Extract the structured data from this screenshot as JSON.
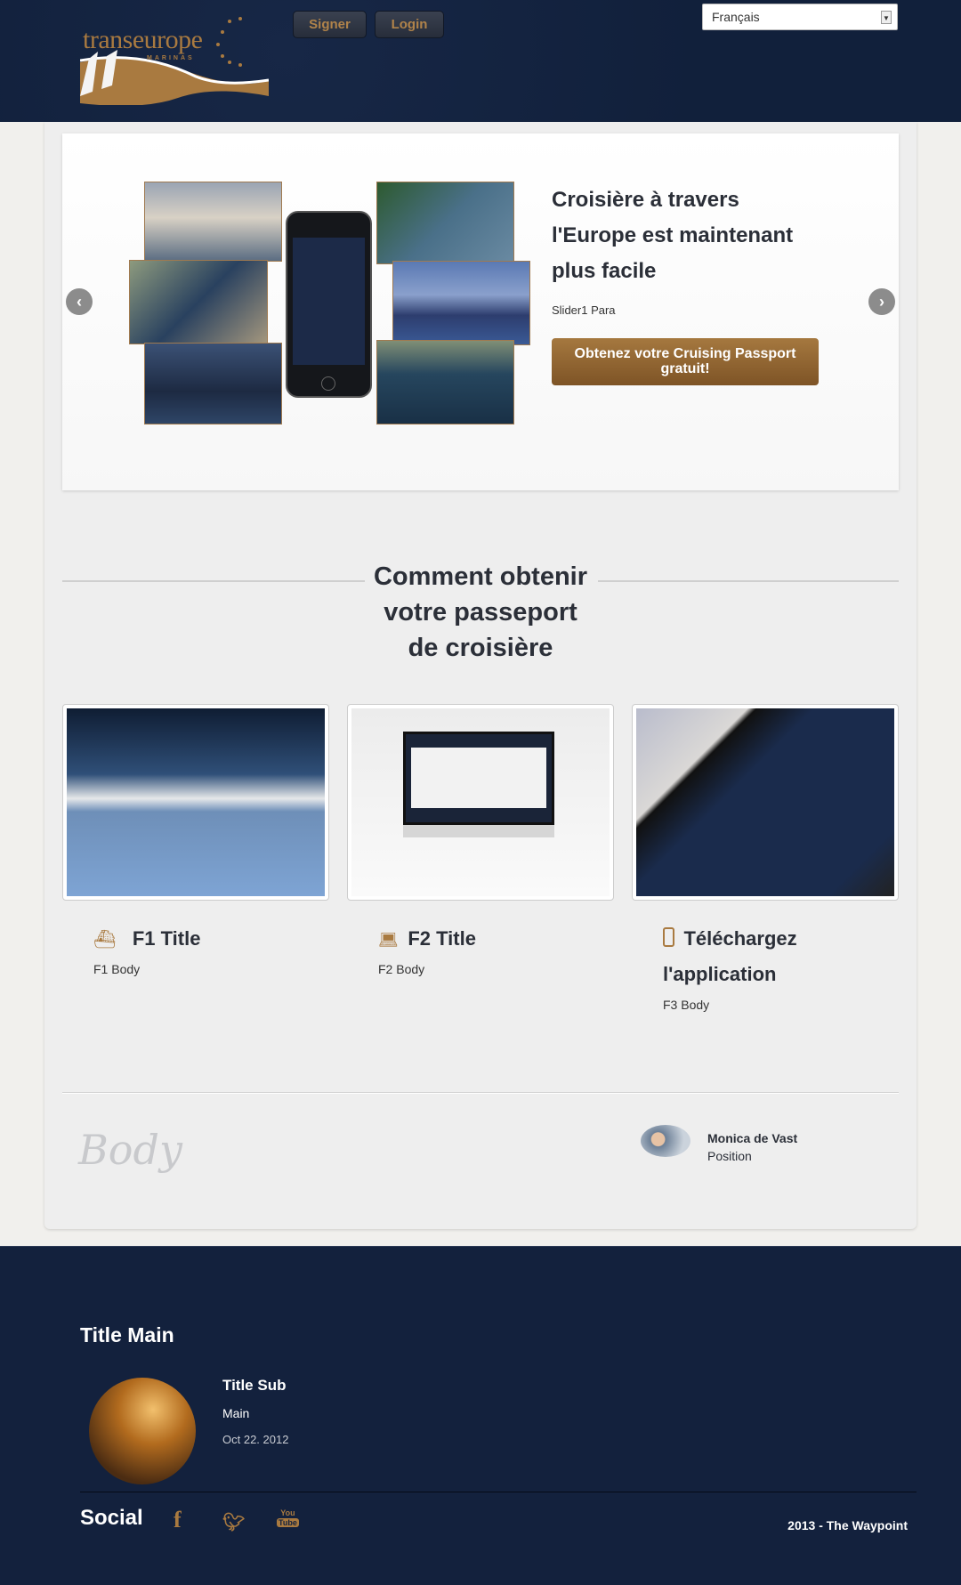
{
  "header": {
    "logo": {
      "text": "transeurope",
      "sub": "MARINAS"
    },
    "signup_label": "Signer",
    "login_label": "Login",
    "language": "Français"
  },
  "slider": {
    "title": "Croisière à travers l'Europe est maintenant plus facile",
    "para": "Slider1 Para",
    "cta_label": "Obtenez votre Cruising Passport gratuit!",
    "prev_icon": "chevron-left-icon",
    "next_icon": "chevron-right-icon"
  },
  "howto": {
    "title_lines": [
      "Comment obtenir",
      "votre passeport",
      "de croisière"
    ],
    "features": [
      {
        "icon": "ship-icon",
        "title": "F1 Title",
        "body": "F1 Body"
      },
      {
        "icon": "laptop-icon",
        "title": "F2 Title",
        "body": "F2 Body"
      },
      {
        "icon": "phone-icon",
        "title": "Téléchargez l'application",
        "body": "F3 Body"
      }
    ]
  },
  "testimonial": {
    "body": "Body",
    "name": "Monica de Vast",
    "position": "Position"
  },
  "footer": {
    "title_main": "Title Main",
    "post": {
      "title": "Title Sub",
      "body": "Main",
      "date": "Oct 22. 2012"
    },
    "social_label": "Social",
    "social": [
      "facebook-icon",
      "twitter-icon",
      "youtube-icon"
    ],
    "copyright": "2013 - The Waypoint"
  },
  "colors": {
    "navy": "#13213d",
    "accent": "#a97a40",
    "background": "#eeeeee"
  }
}
